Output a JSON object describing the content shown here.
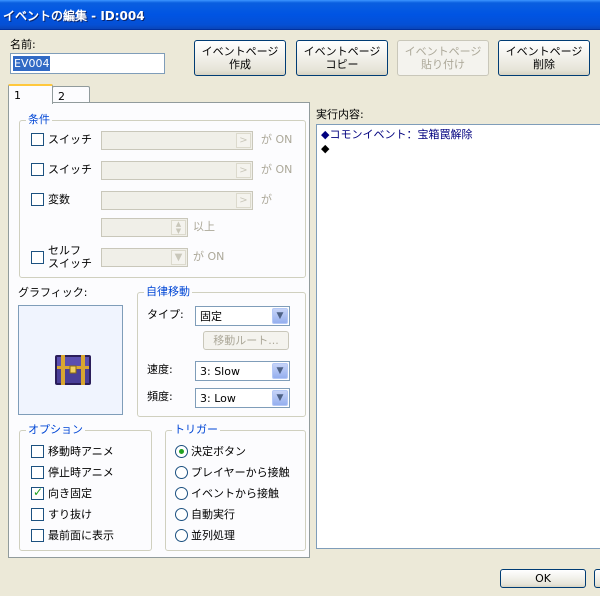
{
  "window": {
    "title": "イベントの編集 - ID:004"
  },
  "name_field": {
    "label": "名前:",
    "value": "EV004"
  },
  "toolbar": {
    "create_page": [
      "イベントページ",
      "作成"
    ],
    "copy_page": [
      "イベントページ",
      "コピー"
    ],
    "paste_page": [
      "イベントページ",
      "貼り付け"
    ],
    "delete_page": [
      "イベントページ",
      "削除"
    ]
  },
  "tabs": [
    {
      "label": "1"
    },
    {
      "label": "2"
    }
  ],
  "conditions": {
    "legend": "条件",
    "switch1": {
      "label": "スイッチ",
      "suffix": "が ON",
      "value": "",
      "btn": ">"
    },
    "switch2": {
      "label": "スイッチ",
      "suffix": "が ON",
      "value": "",
      "btn": ">"
    },
    "variable": {
      "label": "変数",
      "suffix": "が",
      "value": "",
      "btn": ">",
      "min_suffix": "以上",
      "min_value": ""
    },
    "self_switch": {
      "label_line1": "セルフ",
      "label_line2": "スイッチ",
      "suffix": "が ON",
      "value": ""
    }
  },
  "graphic": {
    "label": "グラフィック:",
    "sprite": "treasure-chest"
  },
  "autonomous": {
    "legend": "自律移動",
    "type_label": "タイプ:",
    "type_value": "固定",
    "route_button": "移動ルート...",
    "speed_label": "速度:",
    "speed_value": "3: Slow",
    "freq_label": "頻度:",
    "freq_value": "3: Low"
  },
  "options": {
    "legend": "オプション",
    "items": [
      {
        "label": "移動時アニメ",
        "checked": false
      },
      {
        "label": "停止時アニメ",
        "checked": false
      },
      {
        "label": "向き固定",
        "checked": true
      },
      {
        "label": "すり抜け",
        "checked": false
      },
      {
        "label": "最前面に表示",
        "checked": false
      }
    ]
  },
  "trigger": {
    "legend": "トリガー",
    "items": [
      {
        "label": "決定ボタン",
        "selected": true
      },
      {
        "label": "プレイヤーから接触",
        "selected": false
      },
      {
        "label": "イベントから接触",
        "selected": false
      },
      {
        "label": "自動実行",
        "selected": false
      },
      {
        "label": "並列処理",
        "selected": false
      }
    ]
  },
  "content": {
    "label": "実行内容:",
    "commands": [
      "◆コモンイベント：宝箱罠解除",
      "◆"
    ]
  },
  "footer": {
    "ok_label": "OK"
  },
  "colors": {
    "accent": "#0046d5",
    "titlebar": "#0054e3",
    "text_blue": "#0046d5"
  }
}
